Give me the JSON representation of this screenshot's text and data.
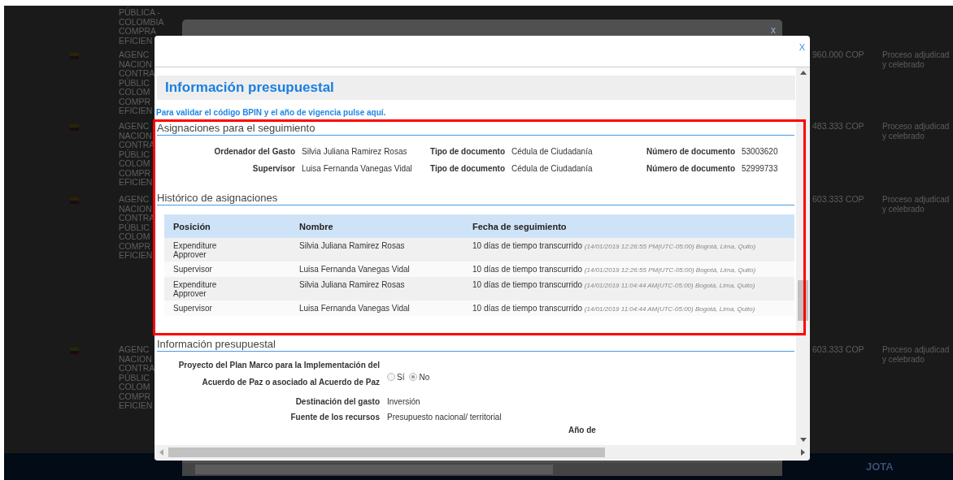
{
  "background": {
    "rows": [
      {
        "flag": false,
        "name_lines": [
          "PÚBLICA -",
          "COLOMBIA",
          "COMPRA",
          "EFICIEN"
        ]
      },
      {
        "flag": true,
        "name_lines": [
          "AGENC",
          "NACION",
          "CONTRA",
          "PÚBLIC",
          "COLOM",
          "COMPR",
          "EFICIEN"
        ],
        "amount": "960.000 COP",
        "status_lines": [
          "Proceso adjudicad",
          "y celebrado"
        ]
      },
      {
        "flag": true,
        "name_lines": [
          "AGENC",
          "NACION",
          "CONTRA",
          "PÚBLIC",
          "COLOM",
          "COMPR",
          "EFICIEN"
        ],
        "amount": "483.333 COP",
        "status_lines": [
          "Proceso adjudicad",
          "y celebrado"
        ]
      },
      {
        "flag": true,
        "name_lines": [
          "AGENC",
          "NACION",
          "CONTRA",
          "PÚBLIC",
          "COLOM",
          "COMPR",
          "EFICIEN"
        ],
        "amount": "603.333 COP",
        "status_lines": [
          "Proceso adjudicad",
          "y celebrado"
        ]
      },
      {
        "flag": true,
        "name_lines": [
          "AGENC",
          "NACION",
          "CONTRA",
          "PÚBLIC",
          "COLOM",
          "COMPR",
          "EFICIEN"
        ],
        "amount": "603.333 COP",
        "status_lines": [
          "Proceso adjudicad",
          "y celebrado"
        ]
      }
    ],
    "footer": "JOTA"
  },
  "back_dialog": {
    "close": "x"
  },
  "dialog": {
    "close": "X",
    "heading": "Información presupuestal",
    "bpin_link": "Para validar el código BPIN y el año de vigencia pulse aquí.",
    "assignments": {
      "title": "Asignaciones para el seguimiento",
      "rows": [
        {
          "role_label": "Ordenador del Gasto",
          "name": "Silvia Juliana Ramirez Rosas",
          "doc_type_label": "Tipo de documento",
          "doc_type": "Cédula de Ciudadanía",
          "doc_number_label": "Número de documento",
          "doc_number": "53003620"
        },
        {
          "role_label": "Supervisor",
          "name": "Luisa Fernanda Vanegas Vidal",
          "doc_type_label": "Tipo de documento",
          "doc_type": "Cédula de Ciudadanía",
          "doc_number_label": "Número de documento",
          "doc_number": "52999733"
        }
      ]
    },
    "history": {
      "title": "Histórico de asignaciones",
      "columns": [
        "Posición",
        "Nombre",
        "Fecha de seguimiento"
      ],
      "rows": [
        {
          "position": "Expenditure Approver",
          "name": "Silvia Juliana Ramirez Rosas",
          "elapsed": "10 días de tiempo transcurrido",
          "timestamp": "(14/01/2019 12:26:55 PM(UTC-05:00) Bogotá, Lima, Quito)"
        },
        {
          "position": "Supervisor",
          "name": "Luisa Fernanda Vanegas Vidal",
          "elapsed": "10 días de tiempo transcurrido",
          "timestamp": "(14/01/2019 12:26:55 PM(UTC-05:00) Bogotá, Lima, Quito)"
        },
        {
          "position": "Expenditure Approver",
          "name": "Silvia Juliana Ramirez Rosas",
          "elapsed": "10 días de tiempo transcurrido",
          "timestamp": "(14/01/2019 11:04:44 AM(UTC-05:00) Bogotá, Lima, Quito)"
        },
        {
          "position": "Supervisor",
          "name": "Luisa Fernanda Vanegas Vidal",
          "elapsed": "10 días de tiempo transcurrido",
          "timestamp": "(14/01/2019 11:04:44 AM(UTC-05:00) Bogotá, Lima, Quito)"
        }
      ]
    },
    "budget": {
      "title": "Información presupuestal",
      "peace_label": "Proyecto del Plan Marco para la Implementación del Acuerdo de Paz o asociado al Acuerdo de Paz",
      "peace_options": [
        {
          "label": "Sí",
          "selected": false
        },
        {
          "label": "No",
          "selected": true
        }
      ],
      "fields": [
        {
          "label": "Destinación del gasto",
          "value": "Inversión"
        },
        {
          "label": "Fuente de los recursos",
          "value": "Presupuesto nacional/ territorial"
        }
      ],
      "cut_label": "Año de"
    }
  }
}
